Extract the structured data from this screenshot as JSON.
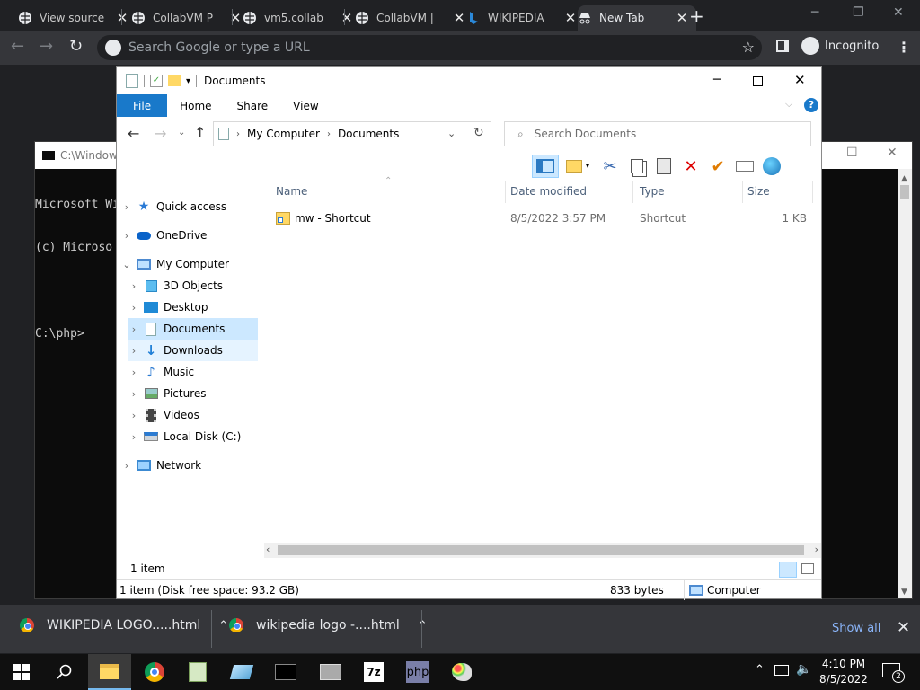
{
  "browser": {
    "tabs": [
      {
        "label": "View source"
      },
      {
        "label": "CollabVM P"
      },
      {
        "label": "vm5.collab"
      },
      {
        "label": "CollabVM | "
      },
      {
        "label": "WIKIPEDIA"
      },
      {
        "label": "New Tab"
      }
    ],
    "omnibox_placeholder": "Search Google or type a URL",
    "incognito_label": "Incognito"
  },
  "cmd": {
    "title": "C:\\Window",
    "lines": [
      "Microsoft Wi",
      "(c) Microso",
      "",
      "C:\\php>"
    ]
  },
  "explorer": {
    "title": "Documents",
    "ribbon_tabs": [
      "File",
      "Home",
      "Share",
      "View"
    ],
    "breadcrumb": [
      "My Computer",
      "Documents"
    ],
    "search_placeholder": "Search Documents",
    "nav": {
      "quick_access": "Quick access",
      "onedrive": "OneDrive",
      "my_computer": "My Computer",
      "objects3d": "3D Objects",
      "desktop": "Desktop",
      "documents": "Documents",
      "downloads": "Downloads",
      "music": "Music",
      "pictures": "Pictures",
      "videos": "Videos",
      "local_disk": "Local Disk (C:)",
      "network": "Network"
    },
    "columns": {
      "name": "Name",
      "date": "Date modified",
      "type": "Type",
      "size": "Size"
    },
    "files": [
      {
        "name": "mw - Shortcut",
        "date": "8/5/2022 3:57 PM",
        "type": "Shortcut",
        "size": "1 KB"
      }
    ],
    "item_count": "1 item",
    "details": {
      "free": "1 item (Disk free space: 93.2 GB)",
      "bytes": "833 bytes",
      "location": "Computer"
    }
  },
  "downloads_bar": {
    "items": [
      {
        "label": "WIKIPEDIA LOGO.....html"
      },
      {
        "label": "wikipedia logo -....html"
      }
    ],
    "show_all": "Show all"
  },
  "taskbar": {
    "clock_time": "4:10 PM",
    "clock_date": "8/5/2022",
    "notification_count": "2"
  }
}
